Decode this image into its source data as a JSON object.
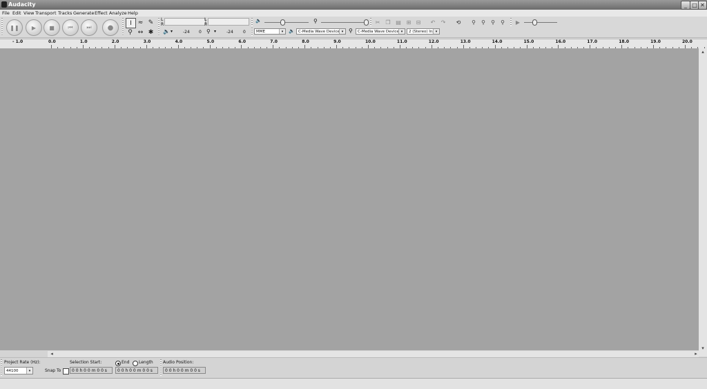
{
  "window": {
    "title": "Audacity",
    "minimize": "_",
    "maximize": "□",
    "close": "✕"
  },
  "menu": [
    "File",
    "Edit",
    "View",
    "Transport",
    "Tracks",
    "Generate",
    "Effect",
    "Analyze",
    "Help"
  ],
  "meters": {
    "playback": {
      "lr_top": "L",
      "lr_bottom": "R",
      "db_left": "-24",
      "db_right": "0"
    },
    "record": {
      "lr_top": "L",
      "lr_bottom": "R",
      "db_left": "-24",
      "db_right": "0"
    }
  },
  "device": {
    "host": "MME",
    "output_device": "C-Media Wave Device",
    "input_device": "C-Media Wave Device :",
    "channels": "2 (Stereo) Inp"
  },
  "ruler": {
    "labels": [
      "- 1.0",
      "0.0",
      "1.0",
      "2.0",
      "3.0",
      "4.0",
      "5.0",
      "6.0",
      "7.0",
      "8.0",
      "9.0",
      "10.0",
      "11.0",
      "12.0",
      "13.0",
      "14.0",
      "15.0",
      "16.0",
      "17.0",
      "18.0",
      "19.0",
      "20.0"
    ]
  },
  "selection": {
    "project_rate_label": "Project Rate (Hz):",
    "project_rate": "44100",
    "snap_to_label": "Snap To",
    "selection_start_label": "Selection Start:",
    "end_label": "End",
    "length_label": "Length",
    "audio_position_label": "Audio Position:",
    "start_time": "0 0 h 0 0 m 0 0 s",
    "end_time": "0 0 h 0 0 m 0 0 s",
    "audio_position": "0 0 h 0 0 m 0 0 s"
  },
  "icons": {
    "pause": "pause-icon",
    "play": "play-icon",
    "stop": "stop-icon",
    "skip_start": "skip-start-icon",
    "skip_end": "skip-end-icon",
    "record": "record-icon"
  }
}
